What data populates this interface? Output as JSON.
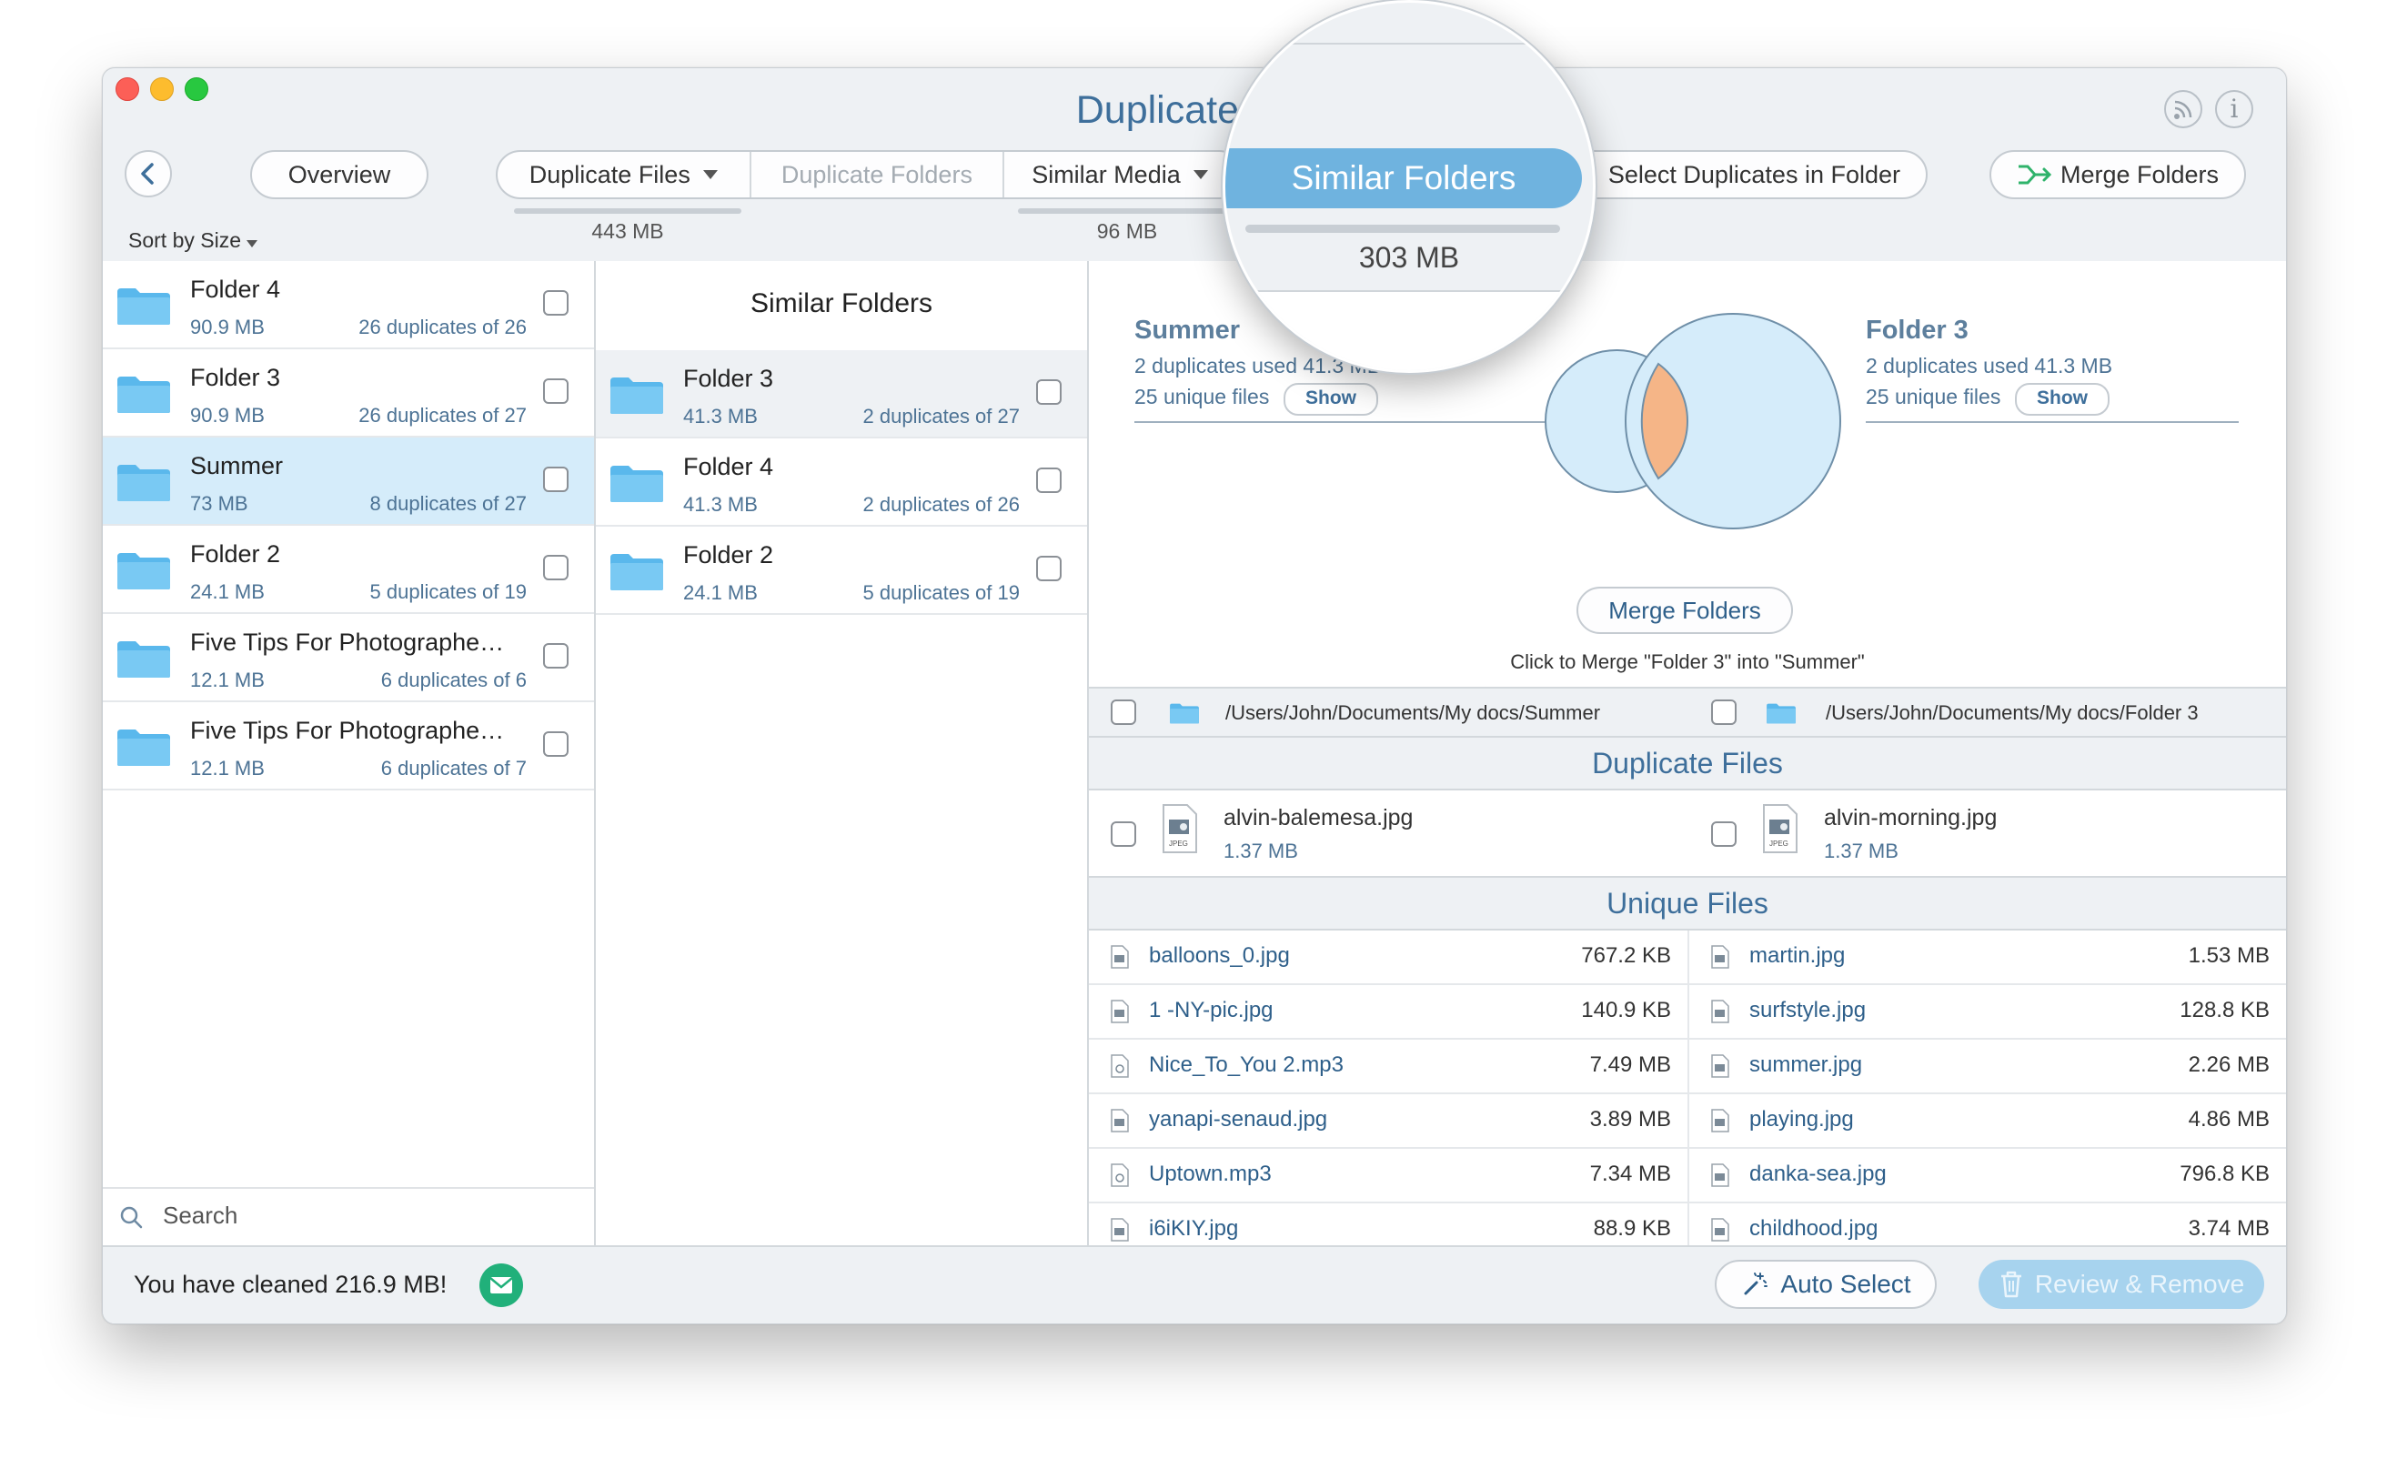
{
  "window": {
    "title": "Duplicate File"
  },
  "toolbar": {
    "overview": "Overview",
    "segments": [
      {
        "label": "Duplicate Files",
        "size": "443 MB"
      },
      {
        "label": "Duplicate Folders"
      },
      {
        "label": "Similar Media",
        "size": "96 MB"
      }
    ],
    "magnified": {
      "label": "Similar Folders",
      "size": "303 MB"
    },
    "select_in_folder": "Select Duplicates in Folder",
    "merge_folders": "Merge Folders"
  },
  "sort": {
    "label": "Sort by Size"
  },
  "left_list": [
    {
      "name": "Folder 4",
      "size": "90.9 MB",
      "dups": "26 duplicates of 26"
    },
    {
      "name": "Folder 3",
      "size": "90.9 MB",
      "dups": "26 duplicates of 27"
    },
    {
      "name": "Summer",
      "size": "73 MB",
      "dups": "8 duplicates of 27"
    },
    {
      "name": "Folder 2",
      "size": "24.1 MB",
      "dups": "5 duplicates of 19"
    },
    {
      "name": "Five Tips For Photographe…",
      "size": "12.1 MB",
      "dups": "6 duplicates of 6"
    },
    {
      "name": "Five Tips For Photographe…",
      "size": "12.1 MB",
      "dups": "6 duplicates of 7"
    }
  ],
  "search": {
    "placeholder": "Search"
  },
  "middle": {
    "title": "Similar Folders",
    "items": [
      {
        "name": "Folder 3",
        "size": "41.3 MB",
        "dups": "2 duplicates of 27"
      },
      {
        "name": "Folder 4",
        "size": "41.3 MB",
        "dups": "2 duplicates of 26"
      },
      {
        "name": "Folder 2",
        "size": "24.1 MB",
        "dups": "5 duplicates of 19"
      }
    ]
  },
  "compare": {
    "left": {
      "name": "Summer",
      "used": "2 duplicates used 41.3 MB",
      "unique": "25 unique files",
      "show": "Show"
    },
    "right": {
      "name": "Folder 3",
      "used": "2 duplicates used 41.3 MB",
      "unique": "25 unique files",
      "show": "Show"
    },
    "merge_button": "Merge Folders",
    "merge_hint": "Click to Merge \"Folder 3\" into \"Summer\"",
    "path_left": "/Users/John/Documents/My docs/Summer",
    "path_right": "/Users/John/Documents/My docs/Folder 3"
  },
  "duplicate_files": {
    "title": "Duplicate Files",
    "left": {
      "name": "alvin-balemesa.jpg",
      "size": "1.37 MB"
    },
    "right": {
      "name": "alvin-morning.jpg",
      "size": "1.37 MB"
    },
    "icon_tag": "JPEG"
  },
  "unique_files": {
    "title": "Unique Files",
    "left": [
      {
        "name": "balloons_0.jpg",
        "size": "767.2 KB"
      },
      {
        "name": "1 -NY-pic.jpg",
        "size": "140.9 KB"
      },
      {
        "name": "Nice_To_You 2.mp3",
        "size": "7.49 MB"
      },
      {
        "name": "yanapi-senaud.jpg",
        "size": "3.89 MB"
      },
      {
        "name": "Uptown.mp3",
        "size": "7.34 MB"
      },
      {
        "name": "i6iKIY.jpg",
        "size": "88.9 KB"
      }
    ],
    "right": [
      {
        "name": "martin.jpg",
        "size": "1.53 MB"
      },
      {
        "name": "surfstyle.jpg",
        "size": "128.8 KB"
      },
      {
        "name": "summer.jpg",
        "size": "2.26 MB"
      },
      {
        "name": "playing.jpg",
        "size": "4.86 MB"
      },
      {
        "name": "danka-sea.jpg",
        "size": "796.8 KB"
      },
      {
        "name": "childhood.jpg",
        "size": "3.74 MB"
      }
    ]
  },
  "footer": {
    "cleaned": "You have cleaned 216.9 MB!",
    "auto_select": "Auto Select",
    "review_remove": "Review & Remove"
  },
  "colors": {
    "accent": "#3e6f9b",
    "selection": "#d5ecfa",
    "folder": "#5ab8ec",
    "overlap": "#f5b587"
  }
}
